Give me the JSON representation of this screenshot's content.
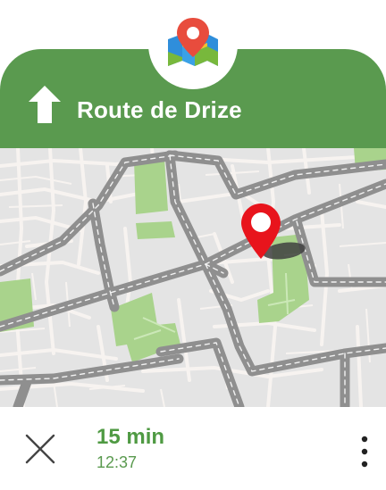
{
  "app": {
    "logo_icon": "map-pin-logo-icon"
  },
  "navigation": {
    "direction_icon": "arrow-up-icon",
    "street_name": "Route de Drize",
    "header_color": "#5a9a4f"
  },
  "map": {
    "destination_icon": "location-pin-icon",
    "pin_color": "#e8141c",
    "road_color": "#8f8f8f",
    "park_color": "#a9d38c",
    "block_color": "#f5f1ee"
  },
  "trip": {
    "duration": "15 min",
    "arrival_time": "12:37",
    "accent_color": "#4f9a43"
  },
  "controls": {
    "close_icon": "close-icon",
    "more_icon": "more-vertical-icon"
  }
}
